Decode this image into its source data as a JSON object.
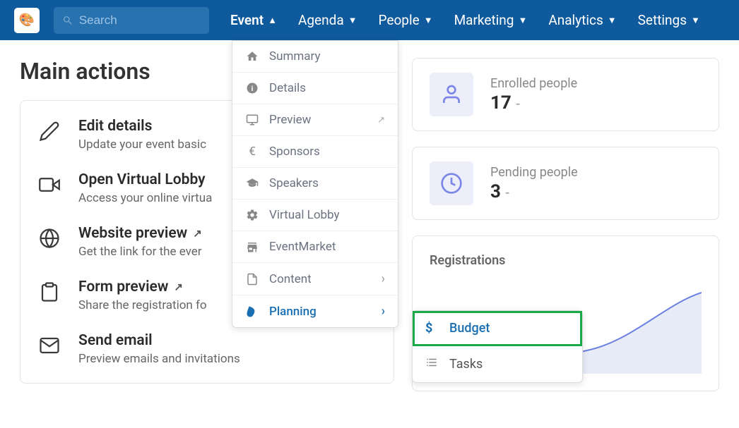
{
  "search": {
    "placeholder": "Search"
  },
  "nav": {
    "items": [
      {
        "label": "Event",
        "active": true,
        "arrow": "up"
      },
      {
        "label": "Agenda"
      },
      {
        "label": "People"
      },
      {
        "label": "Marketing"
      },
      {
        "label": "Analytics"
      },
      {
        "label": "Settings"
      }
    ]
  },
  "page": {
    "title": "Main actions"
  },
  "actions": [
    {
      "title": "Edit details",
      "desc": "Update your event basic"
    },
    {
      "title": "Open Virtual Lobby",
      "desc": "Access your online virtua",
      "badge": true
    },
    {
      "title": "Website preview",
      "desc": "Get the link for the ever",
      "ext": true
    },
    {
      "title": "Form preview",
      "desc": "Share the registration fo",
      "ext": true
    },
    {
      "title": "Send email",
      "desc": "Preview emails and invitations"
    }
  ],
  "stats": {
    "enrolled": {
      "label": "Enrolled people",
      "value": "17",
      "suffix": "-"
    },
    "pending": {
      "label": "Pending people",
      "value": "3",
      "suffix": "-"
    }
  },
  "registrations": {
    "title": "Registrations"
  },
  "dropdown": {
    "items": [
      {
        "label": "Summary",
        "icon": "home"
      },
      {
        "label": "Details",
        "icon": "info"
      },
      {
        "label": "Preview",
        "icon": "monitor",
        "ext": true
      },
      {
        "label": "Sponsors",
        "icon": "euro"
      },
      {
        "label": "Speakers",
        "icon": "grad"
      },
      {
        "label": "Virtual Lobby",
        "icon": "gears"
      },
      {
        "label": "EventMarket",
        "icon": "store"
      },
      {
        "label": "Content",
        "icon": "file",
        "chev": true
      },
      {
        "label": "Planning",
        "icon": "leaf",
        "chev": true,
        "active": true
      }
    ]
  },
  "submenu": {
    "items": [
      {
        "label": "Budget",
        "icon": "dollar",
        "highlighted": true
      },
      {
        "label": "Tasks",
        "icon": "tasks"
      }
    ]
  }
}
